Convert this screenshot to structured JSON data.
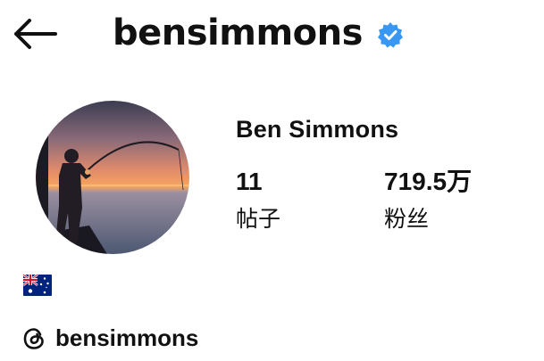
{
  "header": {
    "back_icon": "arrow-left-icon",
    "username": "bensimmons",
    "verified_icon": "verified-badge-icon",
    "verified_color": "#3897f0"
  },
  "profile": {
    "display_name": "Ben Simmons",
    "avatar_description_icon": "profile-photo",
    "stats": [
      {
        "value": "11",
        "label": "帖子"
      },
      {
        "value": "719.5万",
        "label": "粉丝"
      }
    ],
    "flag_icon": "australia-flag-icon",
    "threads_icon": "threads-icon",
    "threads_handle": "bensimmons"
  }
}
